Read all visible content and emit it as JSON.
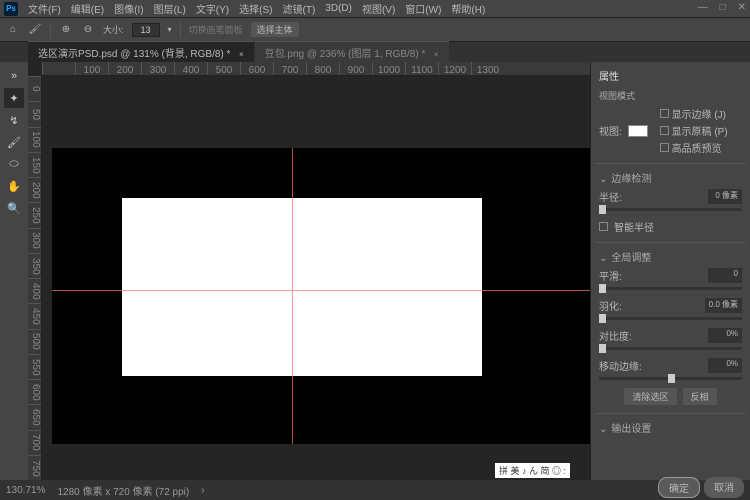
{
  "app_abbr": "Ps",
  "menu": {
    "file": "文件(F)",
    "edit": "编辑(E)",
    "image": "图像(I)",
    "layer": "图层(L)",
    "type": "文字(Y)",
    "select": "选择(S)",
    "filter": "滤镜(T)",
    "threed": "3D(D)",
    "view": "视图(V)",
    "window": "窗口(W)",
    "help": "帮助(H)"
  },
  "winctrl": {
    "min": "—",
    "max": "□",
    "close": "✕"
  },
  "opt": {
    "size_label": "大小:",
    "size_value": "13",
    "toolopt_hint": "切换画笔面板",
    "btn": "选择主体"
  },
  "tabs": [
    {
      "label": "选区演示PSD.psd @ 131% (背景, RGB/8) *",
      "close": "×",
      "active": true
    },
    {
      "label": "豆包.png @ 236% (图层 1, RGB/8) *",
      "close": "×",
      "active": false
    }
  ],
  "ruler_h": [
    "",
    "100",
    "200",
    "300",
    "400",
    "500",
    "600",
    "700",
    "800",
    "900",
    "1000",
    "1100",
    "1200",
    "1300"
  ],
  "ruler_v": [
    "0",
    "50",
    "100",
    "150",
    "200",
    "250",
    "300",
    "350",
    "400",
    "450",
    "500",
    "550",
    "600",
    "650",
    "700",
    "750"
  ],
  "panel": {
    "title": "属性",
    "view_mode": "视图模式",
    "view_lbl": "视图:",
    "show_edge": "显示边缘 (J)",
    "show_orig": "显示原稿 (P)",
    "hq_prev": "高品质预览",
    "edge_detect": "边缘检测",
    "radius": "半径:",
    "radius_val": "0 像素",
    "smart_radius": "智能半径",
    "global_adjust": "全局调整",
    "smooth": "平滑:",
    "smooth_val": "0",
    "feather": "羽化:",
    "feather_val": "0.0 像素",
    "contrast": "对比度:",
    "contrast_val": "0%",
    "shift": "移动边缘:",
    "shift_val": "0%",
    "clear": "清除选区",
    "invert": "反相",
    "output": "输出设置"
  },
  "status": {
    "zoom": "130.71%",
    "dims": "1280 像素 x 720 像素 (72 ppi)"
  },
  "footer": {
    "ok": "确定",
    "cancel": "取消"
  },
  "watermark": "拼 美 ♪ ん 简 ◎ :"
}
